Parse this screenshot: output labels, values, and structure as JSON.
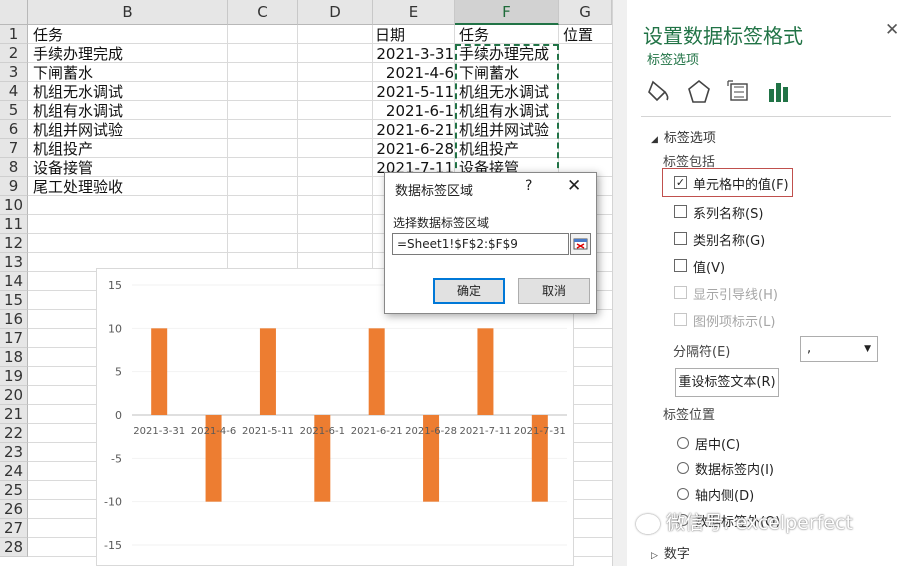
{
  "sheet": {
    "columns": [
      "B",
      "C",
      "D",
      "E",
      "F",
      "G"
    ],
    "rows": [
      "1",
      "2",
      "3",
      "4",
      "5",
      "6",
      "7",
      "8",
      "9",
      "10",
      "11",
      "12",
      "13",
      "14",
      "15",
      "16",
      "17",
      "18",
      "19",
      "20",
      "21",
      "22",
      "23",
      "24",
      "25",
      "26",
      "27",
      "28"
    ],
    "header_task": "任务",
    "header_date": "日期",
    "header_task2": "任务",
    "header_position": "位置",
    "tasks": [
      "手续办理完成",
      "下闸蓄水",
      "机组无水调试",
      "机组有水调试",
      "机组并网试验",
      "机组投产",
      "设备接管",
      "尾工处理验收"
    ],
    "dates": [
      "2021-3-31",
      "2021-4-6",
      "2021-5-11",
      "2021-6-1",
      "2021-6-21",
      "2021-6-28",
      "2021-7-11",
      "2"
    ],
    "tasks_f": [
      "手续办理完成",
      "下闸蓄水",
      "机组无水调试",
      "机组有水调试",
      "机组并网试验",
      "机组投产",
      "设备接管"
    ]
  },
  "chart_data": {
    "type": "bar",
    "categories": [
      "2021-3-31",
      "2021-4-6",
      "2021-5-11",
      "2021-6-1",
      "2021-6-21",
      "2021-6-28",
      "2021-7-11",
      "2021-7-31"
    ],
    "values": [
      10,
      -10,
      10,
      -10,
      10,
      -10,
      10,
      -10
    ],
    "yticks": [
      "15",
      "10",
      "5",
      "0",
      "-5",
      "-10",
      "-15"
    ],
    "ylim": [
      -15,
      15
    ],
    "bar_color": "#ED7D31"
  },
  "dialog": {
    "title": "数据标签区域",
    "help": "?",
    "close": "✕",
    "prompt": "选择数据标签区域",
    "range_value": "=Sheet1!$F$2:$F$9",
    "ok": "确定",
    "cancel": "取消"
  },
  "panel": {
    "title": "设置数据标签格式",
    "close": "✕",
    "subtitle": "标签选项",
    "section_label_options": "标签选项",
    "label_contains": "标签包括",
    "options": [
      {
        "label": "单元格中的值(F)",
        "checked": true,
        "disabled": false
      },
      {
        "label": "系列名称(S)",
        "checked": false,
        "disabled": false
      },
      {
        "label": "类别名称(G)",
        "checked": false,
        "disabled": false
      },
      {
        "label": "值(V)",
        "checked": false,
        "disabled": false
      },
      {
        "label": "显示引导线(H)",
        "checked": false,
        "disabled": true
      },
      {
        "label": "图例项标示(L)",
        "checked": false,
        "disabled": true
      }
    ],
    "separator_label": "分隔符(E)",
    "separator_value": ",",
    "reset_button": "重设标签文本(R)",
    "label_position": "标签位置",
    "positions": [
      "居中(C)",
      "数据标签内(I)",
      "轴内侧(D)",
      "数据标签外(O)"
    ],
    "number_section": "数字",
    "accent": "#217346"
  },
  "watermark": "微信号: excelperfect"
}
